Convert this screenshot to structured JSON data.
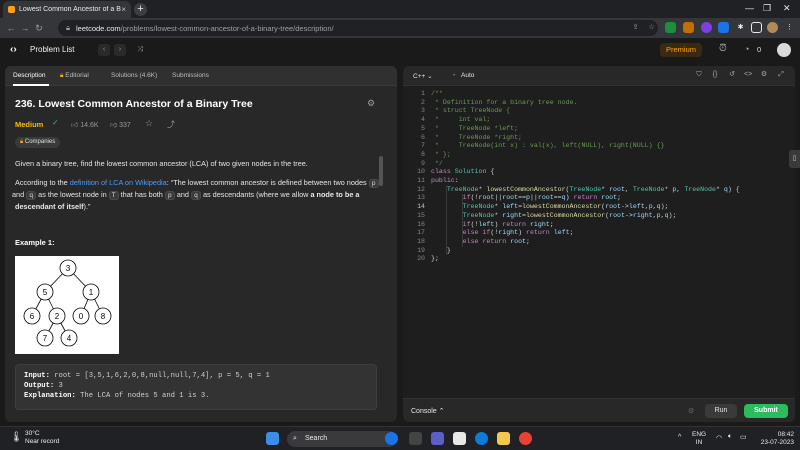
{
  "browser": {
    "tab_title": "Lowest Common Ancestor of a Bi",
    "tab_close": "×",
    "new_tab": "+",
    "win_min": "—",
    "win_max": "❐",
    "win_close": "✕",
    "url_host": "leetcode.com",
    "url_path": "/problems/lowest-common-ancestor-of-a-binary-tree/description/"
  },
  "header": {
    "problem_list": "Problem List",
    "premium": "Premium",
    "streak": "0"
  },
  "left_tabs": {
    "description": "Description",
    "editorial": "Editorial",
    "solutions": "Solutions (4.6K)",
    "submissions": "Submissions"
  },
  "problem": {
    "title": "236. Lowest Common Ancestor of a Binary Tree",
    "difficulty": "Medium",
    "likes": "14.6K",
    "dislikes": "337",
    "companies": "Companies",
    "intro": "Given a binary tree, find the lowest common ancestor (LCA) of two given nodes in the tree.",
    "p2_a": "According to the ",
    "p2_link": "definition of LCA on Wikipedia",
    "p2_b": ": “The lowest common ancestor is defined between two nodes ",
    "p2_p": "p",
    "p2_c": " and ",
    "p2_q": "q",
    "p2_d": " as the lowest node in ",
    "p2_T": "T",
    "p2_e": " that has both ",
    "p2_f": " and ",
    "p2_g": " as descendants (where we allow ",
    "p2_bold": "a node to be a descendant of itself",
    "p2_h": ").”",
    "example_title": "Example 1:",
    "ex_input_label": "Input:",
    "ex_input": " root = [3,5,1,6,2,0,8,null,null,7,4], p = 5, q = 1",
    "ex_output_label": "Output:",
    "ex_output": " 3",
    "ex_expl_label": "Explanation:",
    "ex_expl": " The LCA of nodes 5 and 1 is 3.",
    "tree_nodes": [
      "3",
      "5",
      "1",
      "6",
      "2",
      "0",
      "8",
      "7",
      "4"
    ]
  },
  "editor": {
    "language": "C++",
    "mode": "Auto",
    "lines": [
      "/**",
      " * Definition for a binary tree node.",
      " * struct TreeNode {",
      " *     int val;",
      " *     TreeNode *left;",
      " *     TreeNode *right;",
      " *     TreeNode(int x) : val(x), left(NULL), right(NULL) {}",
      " * };",
      " */",
      "class Solution {",
      "public:",
      "    TreeNode* lowestCommonAncestor(TreeNode* root, TreeNode* p, TreeNode* q) {",
      "        if(!root||root==p||root==q) return root;",
      "        TreeNode* left=lowestCommonAncestor(root->left,p,q);",
      "        TreeNode* right=lowestCommonAncestor(root->right,p,q);",
      "        if(!left) return right;",
      "        else if(!right) return left;",
      "        else return root;",
      "    }",
      "};"
    ],
    "line_numbers": [
      "1",
      "2",
      "3",
      "4",
      "5",
      "6",
      "7",
      "8",
      "9",
      "10",
      "11",
      "12",
      "13",
      "14",
      "15",
      "16",
      "17",
      "18",
      "19",
      "20"
    ],
    "console": "Console",
    "run": "Run",
    "submit": "Submit"
  },
  "taskbar": {
    "temp": "30°C",
    "weather": "Near record",
    "search": "Search",
    "lang1": "ENG",
    "lang2": "IN",
    "time": "08:42",
    "date": "23-07-2023"
  },
  "colors": {
    "accent": "#ffa116",
    "medium": "#ffb800",
    "submit": "#2cbb5d",
    "link": "#4e9cf6"
  }
}
